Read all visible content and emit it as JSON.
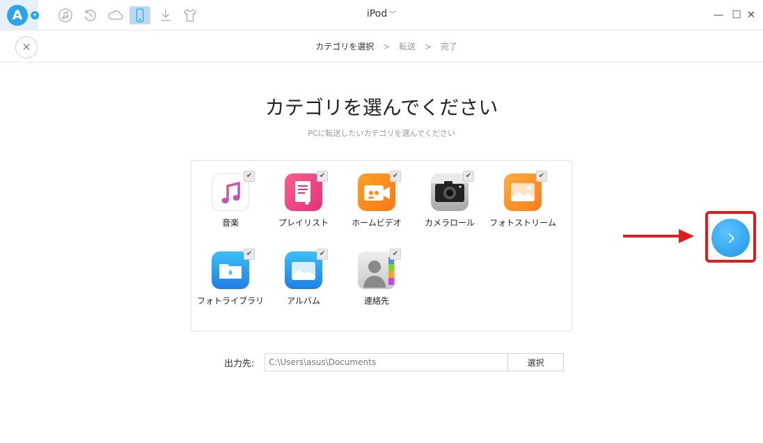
{
  "titlebar": {
    "logo_letter": "A",
    "device_name": "iPod",
    "icons": [
      "music-icon",
      "restore-icon",
      "cloud-icon",
      "device-icon",
      "download-icon",
      "tshirt-icon"
    ]
  },
  "steps": {
    "step1": "カテゴリを選択",
    "sep1": ">",
    "step2": "転送",
    "sep2": ">",
    "step3": "完了"
  },
  "main": {
    "title": "カテゴリを選んでください",
    "subtitle": "PCに転送したいカテゴリを選んでください"
  },
  "categories": [
    {
      "label": "音楽",
      "icon": "music-app-icon",
      "checked": true
    },
    {
      "label": "プレイリスト",
      "icon": "playlist-icon",
      "checked": true
    },
    {
      "label": "ホームビデオ",
      "icon": "home-video-icon",
      "checked": true
    },
    {
      "label": "カメラロール",
      "icon": "camera-roll-icon",
      "checked": true
    },
    {
      "label": "フォトストリーム",
      "icon": "photo-stream-icon",
      "checked": true
    },
    {
      "label": "フォトライブラリ",
      "icon": "photo-library-icon",
      "checked": true
    },
    {
      "label": "アルバム",
      "icon": "album-icon",
      "checked": true
    },
    {
      "label": "連絡先",
      "icon": "contacts-icon",
      "checked": true
    }
  ],
  "output": {
    "label": "出力先:",
    "path": "C:\\Users\\asus\\Documents",
    "browse_label": "選択"
  },
  "colors": {
    "accent": "#2aa4ec",
    "annotation": "#e21b1b"
  }
}
